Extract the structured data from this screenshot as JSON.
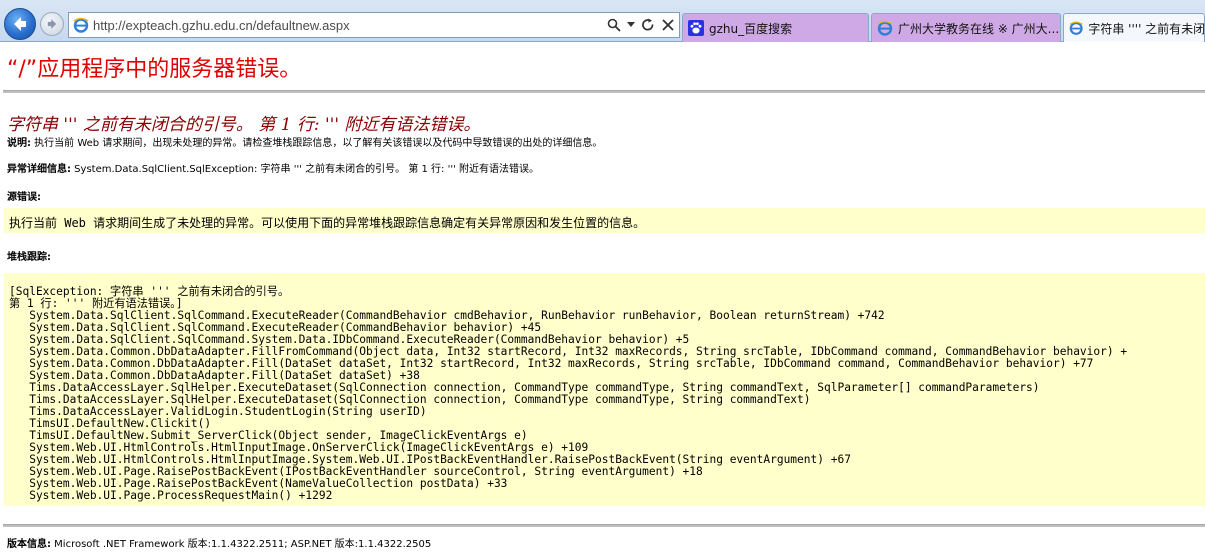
{
  "browser": {
    "url": "http://expteach.gzhu.edu.cn/defaultnew.aspx",
    "tabs": [
      {
        "label": "gzhu_百度搜索",
        "icon": "baidu-paw-icon",
        "active": false
      },
      {
        "label": "广州大学教务在线 ※ 广州大...",
        "icon": "ie-page-icon",
        "active": false
      },
      {
        "label": "字符串 '''' 之前有未闭合",
        "icon": "ie-page-icon",
        "active": true
      }
    ]
  },
  "page": {
    "title": "“/”应用程序中的服务器错误。",
    "error_heading": "字符串 ''' 之前有未闭合的引号。 第 1 行: ''' 附近有语法错误。",
    "description_label": "说明:",
    "description_text": " 执行当前 Web 请求期间，出现未处理的异常。请检查堆栈跟踪信息，以了解有关该错误以及代码中导致错误的出处的详细信息。",
    "exception_label": "异常详细信息:",
    "exception_text": " System.Data.SqlClient.SqlException: 字符串 ''' 之前有未闭合的引号。 第 1 行: ''' 附近有语法错误。",
    "source_error_label": "源错误:",
    "source_error_text": "执行当前 Web 请求期间生成了未处理的异常。可以使用下面的异常堆栈跟踪信息确定有关异常原因和发生位置的信息。",
    "stack_trace_label": "堆栈跟踪:",
    "stack_trace": [
      "[SqlException: 字符串 ''' 之前有未闭合的引号。",
      "第 1 行: ''' 附近有语法错误。]",
      "   System.Data.SqlClient.SqlCommand.ExecuteReader(CommandBehavior cmdBehavior, RunBehavior runBehavior, Boolean returnStream) +742",
      "   System.Data.SqlClient.SqlCommand.ExecuteReader(CommandBehavior behavior) +45",
      "   System.Data.SqlClient.SqlCommand.System.Data.IDbCommand.ExecuteReader(CommandBehavior behavior) +5",
      "   System.Data.Common.DbDataAdapter.FillFromCommand(Object data, Int32 startRecord, Int32 maxRecords, String srcTable, IDbCommand command, CommandBehavior behavior) +",
      "   System.Data.Common.DbDataAdapter.Fill(DataSet dataSet, Int32 startRecord, Int32 maxRecords, String srcTable, IDbCommand command, CommandBehavior behavior) +77",
      "   System.Data.Common.DbDataAdapter.Fill(DataSet dataSet) +38",
      "   Tims.DataAccessLayer.SqlHelper.ExecuteDataset(SqlConnection connection, CommandType commandType, String commandText, SqlParameter[] commandParameters)",
      "   Tims.DataAccessLayer.SqlHelper.ExecuteDataset(SqlConnection connection, CommandType commandType, String commandText)",
      "   Tims.DataAccessLayer.ValidLogin.StudentLogin(String userID)",
      "   TimsUI.DefaultNew.Clickit()",
      "   TimsUI.DefaultNew.Submit_ServerClick(Object sender, ImageClickEventArgs e)",
      "   System.Web.UI.HtmlControls.HtmlInputImage.OnServerClick(ImageClickEventArgs e) +109",
      "   System.Web.UI.HtmlControls.HtmlInputImage.System.Web.UI.IPostBackEventHandler.RaisePostBackEvent(String eventArgument) +67",
      "   System.Web.UI.Page.RaisePostBackEvent(IPostBackEventHandler sourceControl, String eventArgument) +18",
      "   System.Web.UI.Page.RaisePostBackEvent(NameValueCollection postData) +33",
      "   System.Web.UI.Page.ProcessRequestMain() +1292"
    ],
    "version_label": "版本信息:",
    "version_text": " Microsoft .NET Framework 版本:1.1.4322.2511; ASP.NET 版本:1.1.4322.2505"
  }
}
